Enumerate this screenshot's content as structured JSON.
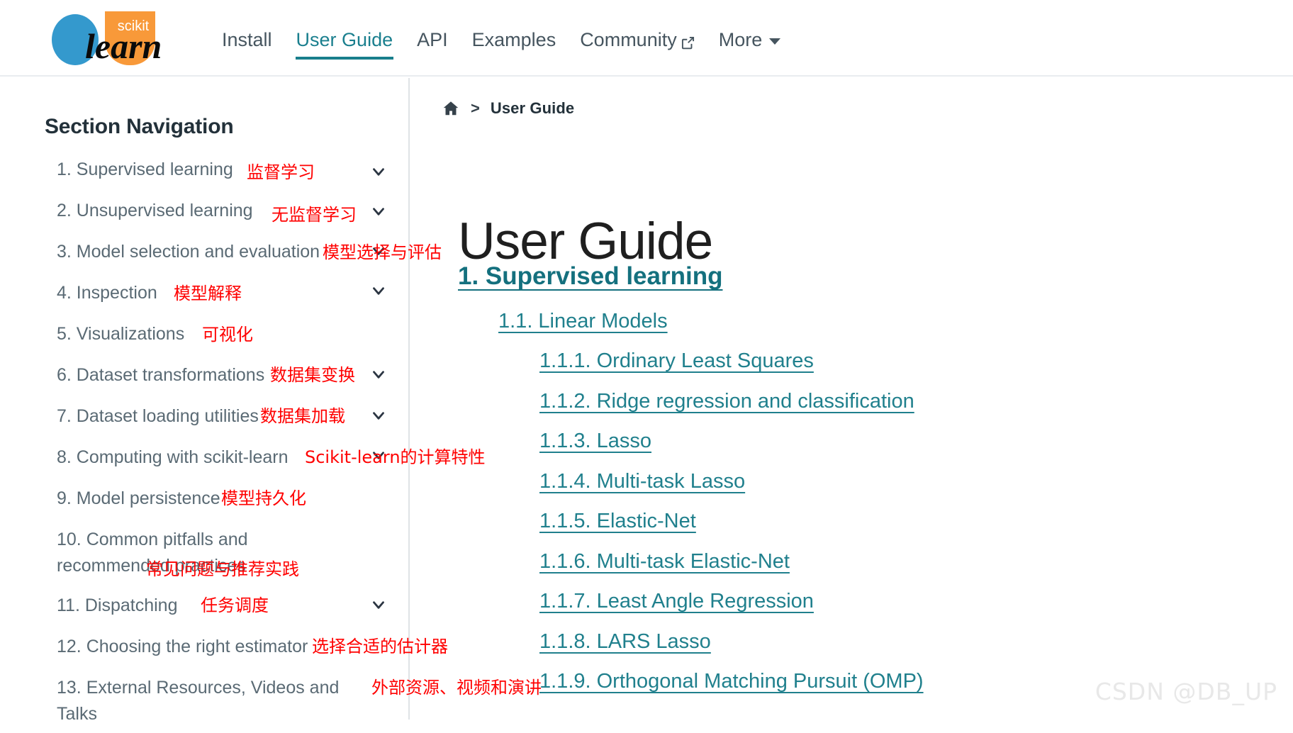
{
  "header": {
    "logo": {
      "alt": "scikit-learn",
      "text_top": "scikit",
      "text_main": "learn",
      "blue": "#3499cd",
      "orange": "#f89939"
    },
    "nav": [
      {
        "label": "Install",
        "active": false,
        "external": false,
        "dropdown": false
      },
      {
        "label": "User Guide",
        "active": true,
        "external": false,
        "dropdown": false
      },
      {
        "label": "API",
        "active": false,
        "external": false,
        "dropdown": false
      },
      {
        "label": "Examples",
        "active": false,
        "external": false,
        "dropdown": false
      },
      {
        "label": "Community",
        "active": false,
        "external": true,
        "dropdown": false
      },
      {
        "label": "More",
        "active": false,
        "external": false,
        "dropdown": true
      }
    ],
    "active_color": "#197f8c",
    "link_color": "#46555f"
  },
  "sidebar": {
    "title": "Section Navigation",
    "items": [
      {
        "label": "1. Supervised learning",
        "annotation": "监督学习",
        "chevron": true
      },
      {
        "label": "2. Unsupervised learning",
        "annotation": "无监督学习",
        "chevron": true
      },
      {
        "label": "3. Model selection and evaluation",
        "annotation": "模型选择与评估",
        "chevron": true
      },
      {
        "label": "4. Inspection",
        "annotation": "模型解释",
        "chevron": true
      },
      {
        "label": "5. Visualizations",
        "annotation": "可视化",
        "chevron": false
      },
      {
        "label": "6. Dataset transformations",
        "annotation": "数据集变换",
        "chevron": true
      },
      {
        "label": "7. Dataset loading utilities",
        "annotation": "数据集加载",
        "chevron": true
      },
      {
        "label": "8. Computing with scikit-learn",
        "annotation": "Scikit-learn的计算特性",
        "chevron": true
      },
      {
        "label": "9. Model persistence",
        "annotation": "模型持久化",
        "chevron": false
      },
      {
        "label": "10. Common pitfalls and recommended practices",
        "annotation": "常见问题与推荐实践",
        "chevron": false
      },
      {
        "label": "11. Dispatching",
        "annotation": "任务调度",
        "chevron": true
      },
      {
        "label": "12. Choosing the right estimator",
        "annotation": "选择合适的估计器",
        "chevron": false
      },
      {
        "label": "13. External Resources, Videos and Talks",
        "annotation": "外部资源、视频和演讲",
        "chevron": false
      }
    ],
    "annotation_color": "#ff0000"
  },
  "main": {
    "breadcrumb": {
      "home_icon": "home-icon",
      "separator": ">",
      "current": "User Guide"
    },
    "page_title": "User Guide",
    "toc": {
      "level1": "1. Supervised learning",
      "level2": "1.1. Linear Models",
      "level3": [
        "1.1.1. Ordinary Least Squares",
        "1.1.2. Ridge regression and classification",
        "1.1.3. Lasso",
        "1.1.4. Multi-task Lasso",
        "1.1.5. Elastic-Net",
        "1.1.6. Multi-task Elastic-Net",
        "1.1.7. Least Angle Regression",
        "1.1.8. LARS Lasso",
        "1.1.9. Orthogonal Matching Pursuit (OMP)"
      ]
    },
    "link_color": "#20808d"
  },
  "watermark": "CSDN @DB_UP"
}
